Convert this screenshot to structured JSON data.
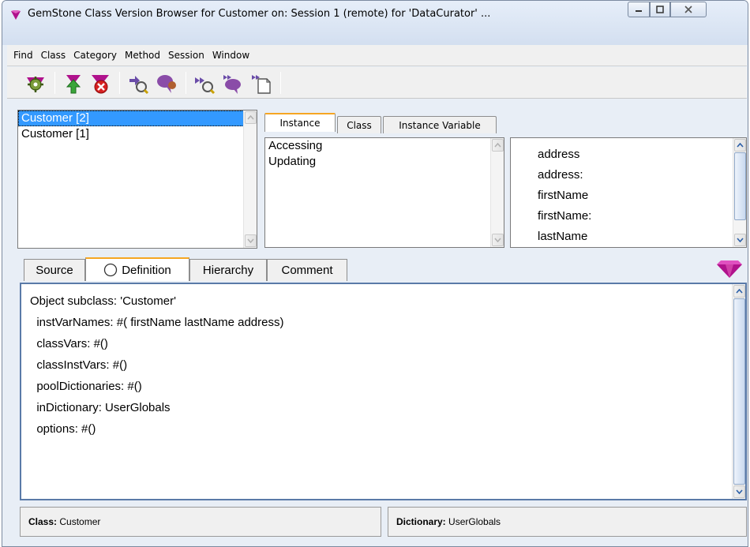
{
  "window": {
    "title": "GemStone Class Version Browser for Customer on: Session 1 (remote) for 'DataCurator' ..."
  },
  "menu": [
    "Find",
    "Class",
    "Category",
    "Method",
    "Session",
    "Window"
  ],
  "toolbar": {
    "icons": [
      "new-class-gem-gear",
      "gem-up-arrow",
      "gem-delete",
      "senders",
      "implementors",
      "senders-of",
      "implementors-of",
      "method-list"
    ]
  },
  "class_versions": [
    {
      "label": "Customer [2]",
      "selected": true
    },
    {
      "label": "Customer [1]",
      "selected": false
    }
  ],
  "category_tabs": {
    "instance": "Instance",
    "class": "Class",
    "instance_variable": "Instance Variable",
    "active": "instance"
  },
  "categories": [
    "Accessing",
    "Updating"
  ],
  "methods": [
    "address",
    "address:",
    "firstName",
    "firstName:",
    "lastName"
  ],
  "editor_tabs": {
    "source": "Source",
    "definition": "Definition",
    "hierarchy": "Hierarchy",
    "comment": "Comment",
    "active": "definition"
  },
  "definition_lines": [
    "Object subclass: 'Customer'",
    "  instVarNames: #( firstName lastName address)",
    "  classVars: #()",
    "  classInstVars: #()",
    "  poolDictionaries: #()",
    "  inDictionary: UserGlobals",
    "  options: #()"
  ],
  "status": {
    "class_label": "Class:",
    "class_value": "Customer",
    "dictionary_label": "Dictionary:",
    "dictionary_value": "UserGlobals"
  },
  "colors": {
    "gem": "#b0128c",
    "selection": "#3399ff",
    "active_tab_accent": "#f5a623"
  }
}
